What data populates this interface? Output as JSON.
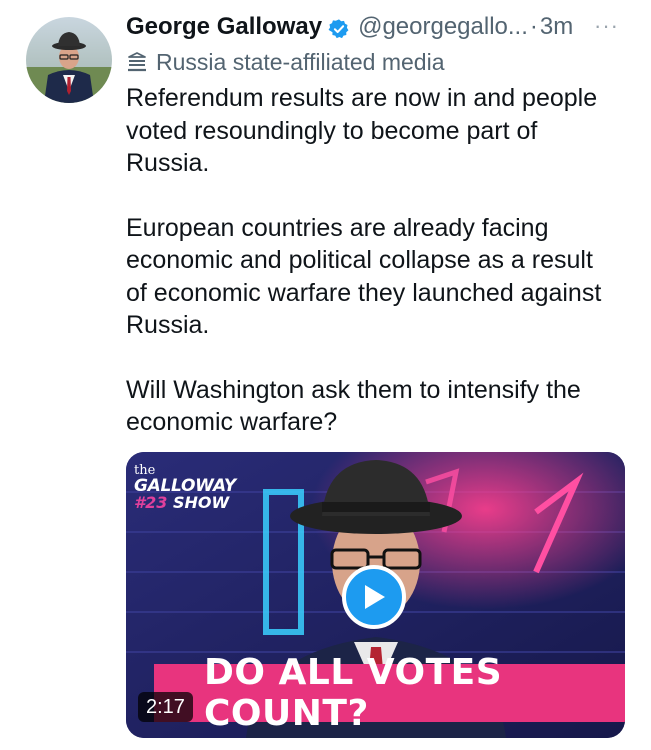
{
  "tweet": {
    "author_name": "George Galloway",
    "handle": "@georgegallo...",
    "separator": "·",
    "time": "3m",
    "more_label": "···",
    "affiliation_label": "Russia state-affiliated media",
    "paragraphs": [
      "Referendum results are now in and people\nvoted resoundingly to become part of\nRussia.",
      "European countries are already facing\neconomic and political collapse as a result\nof economic warfare they launched against\nRussia.",
      "Will Washington ask them to intensify the\neconomic warfare?"
    ]
  },
  "video": {
    "show_logo": {
      "line1": "the",
      "line2": "GALLOWAY",
      "number": "#23",
      "show": "SHOW"
    },
    "banner_text": "DO ALL VOTES COUNT?",
    "duration": "2:17"
  },
  "colors": {
    "verified_badge": "#1d9bf0",
    "play_button": "#1d9bf0",
    "banner": "#e8347e",
    "secondary_text": "#536471"
  },
  "icons": {
    "verified": "verified-badge-icon",
    "affiliation": "government-building-icon",
    "more": "more-options-icon",
    "play": "play-icon"
  }
}
